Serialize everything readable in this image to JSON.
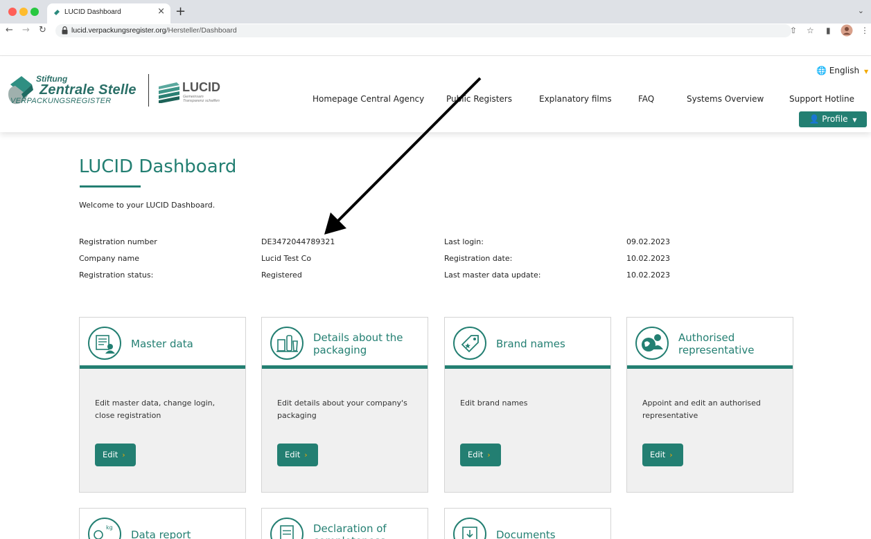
{
  "browser": {
    "tab_title": "LUCID Dashboard",
    "url_host": "lucid.verpackungsregister.org",
    "url_path": "/Hersteller/Dashboard",
    "close_glyph": "×",
    "newtab_glyph": "+"
  },
  "header": {
    "logo": {
      "stiftung": "Stiftung",
      "zentrale": "Zentrale Stelle",
      "register": "VERPACKUNGSREGISTER",
      "lucid": "LUCID",
      "tagline_1": "Gemeinsam",
      "tagline_2": "Transparenz schaffen"
    },
    "language": "English",
    "menu": [
      "Homepage Central Agency",
      "Public Registers",
      "Explanatory films",
      "FAQ",
      "Systems Overview",
      "Support Hotline"
    ],
    "profile_label": "Profile"
  },
  "main": {
    "title": "LUCID Dashboard",
    "welcome": "Welcome to your LUCID Dashboard.",
    "info_left": [
      {
        "label": "Registration number",
        "value": "DE3472044789321"
      },
      {
        "label": "Company name",
        "value": "Lucid Test Co"
      },
      {
        "label": "Registration status:",
        "value": "Registered"
      }
    ],
    "info_right": [
      {
        "label": "Last login:",
        "value": "09.02.2023"
      },
      {
        "label": "Registration date:",
        "value": "10.02.2023"
      },
      {
        "label": "Last master data update:",
        "value": "10.02.2023"
      }
    ],
    "cards": [
      {
        "title_1": "Master data",
        "title_2": "",
        "desc": "Edit master data, change login, close registration",
        "button": "Edit"
      },
      {
        "title_1": "Details about the",
        "title_2": "packaging",
        "desc": "Edit details about your company's packaging",
        "button": "Edit"
      },
      {
        "title_1": "Brand names",
        "title_2": "",
        "desc": "Edit brand names",
        "button": "Edit"
      },
      {
        "title_1": "Authorised",
        "title_2": "representative",
        "desc": "Appoint and edit an authorised representative",
        "button": "Edit"
      }
    ],
    "cards_row2": [
      {
        "title_1": "Data report",
        "title_2": ""
      },
      {
        "title_1": "Declaration of",
        "title_2": "completeness"
      },
      {
        "title_1": "Documents",
        "title_2": ""
      }
    ]
  },
  "colors": {
    "accent": "#237f72",
    "highlight": "#f2a900",
    "card_bg": "#f0f0f0"
  }
}
